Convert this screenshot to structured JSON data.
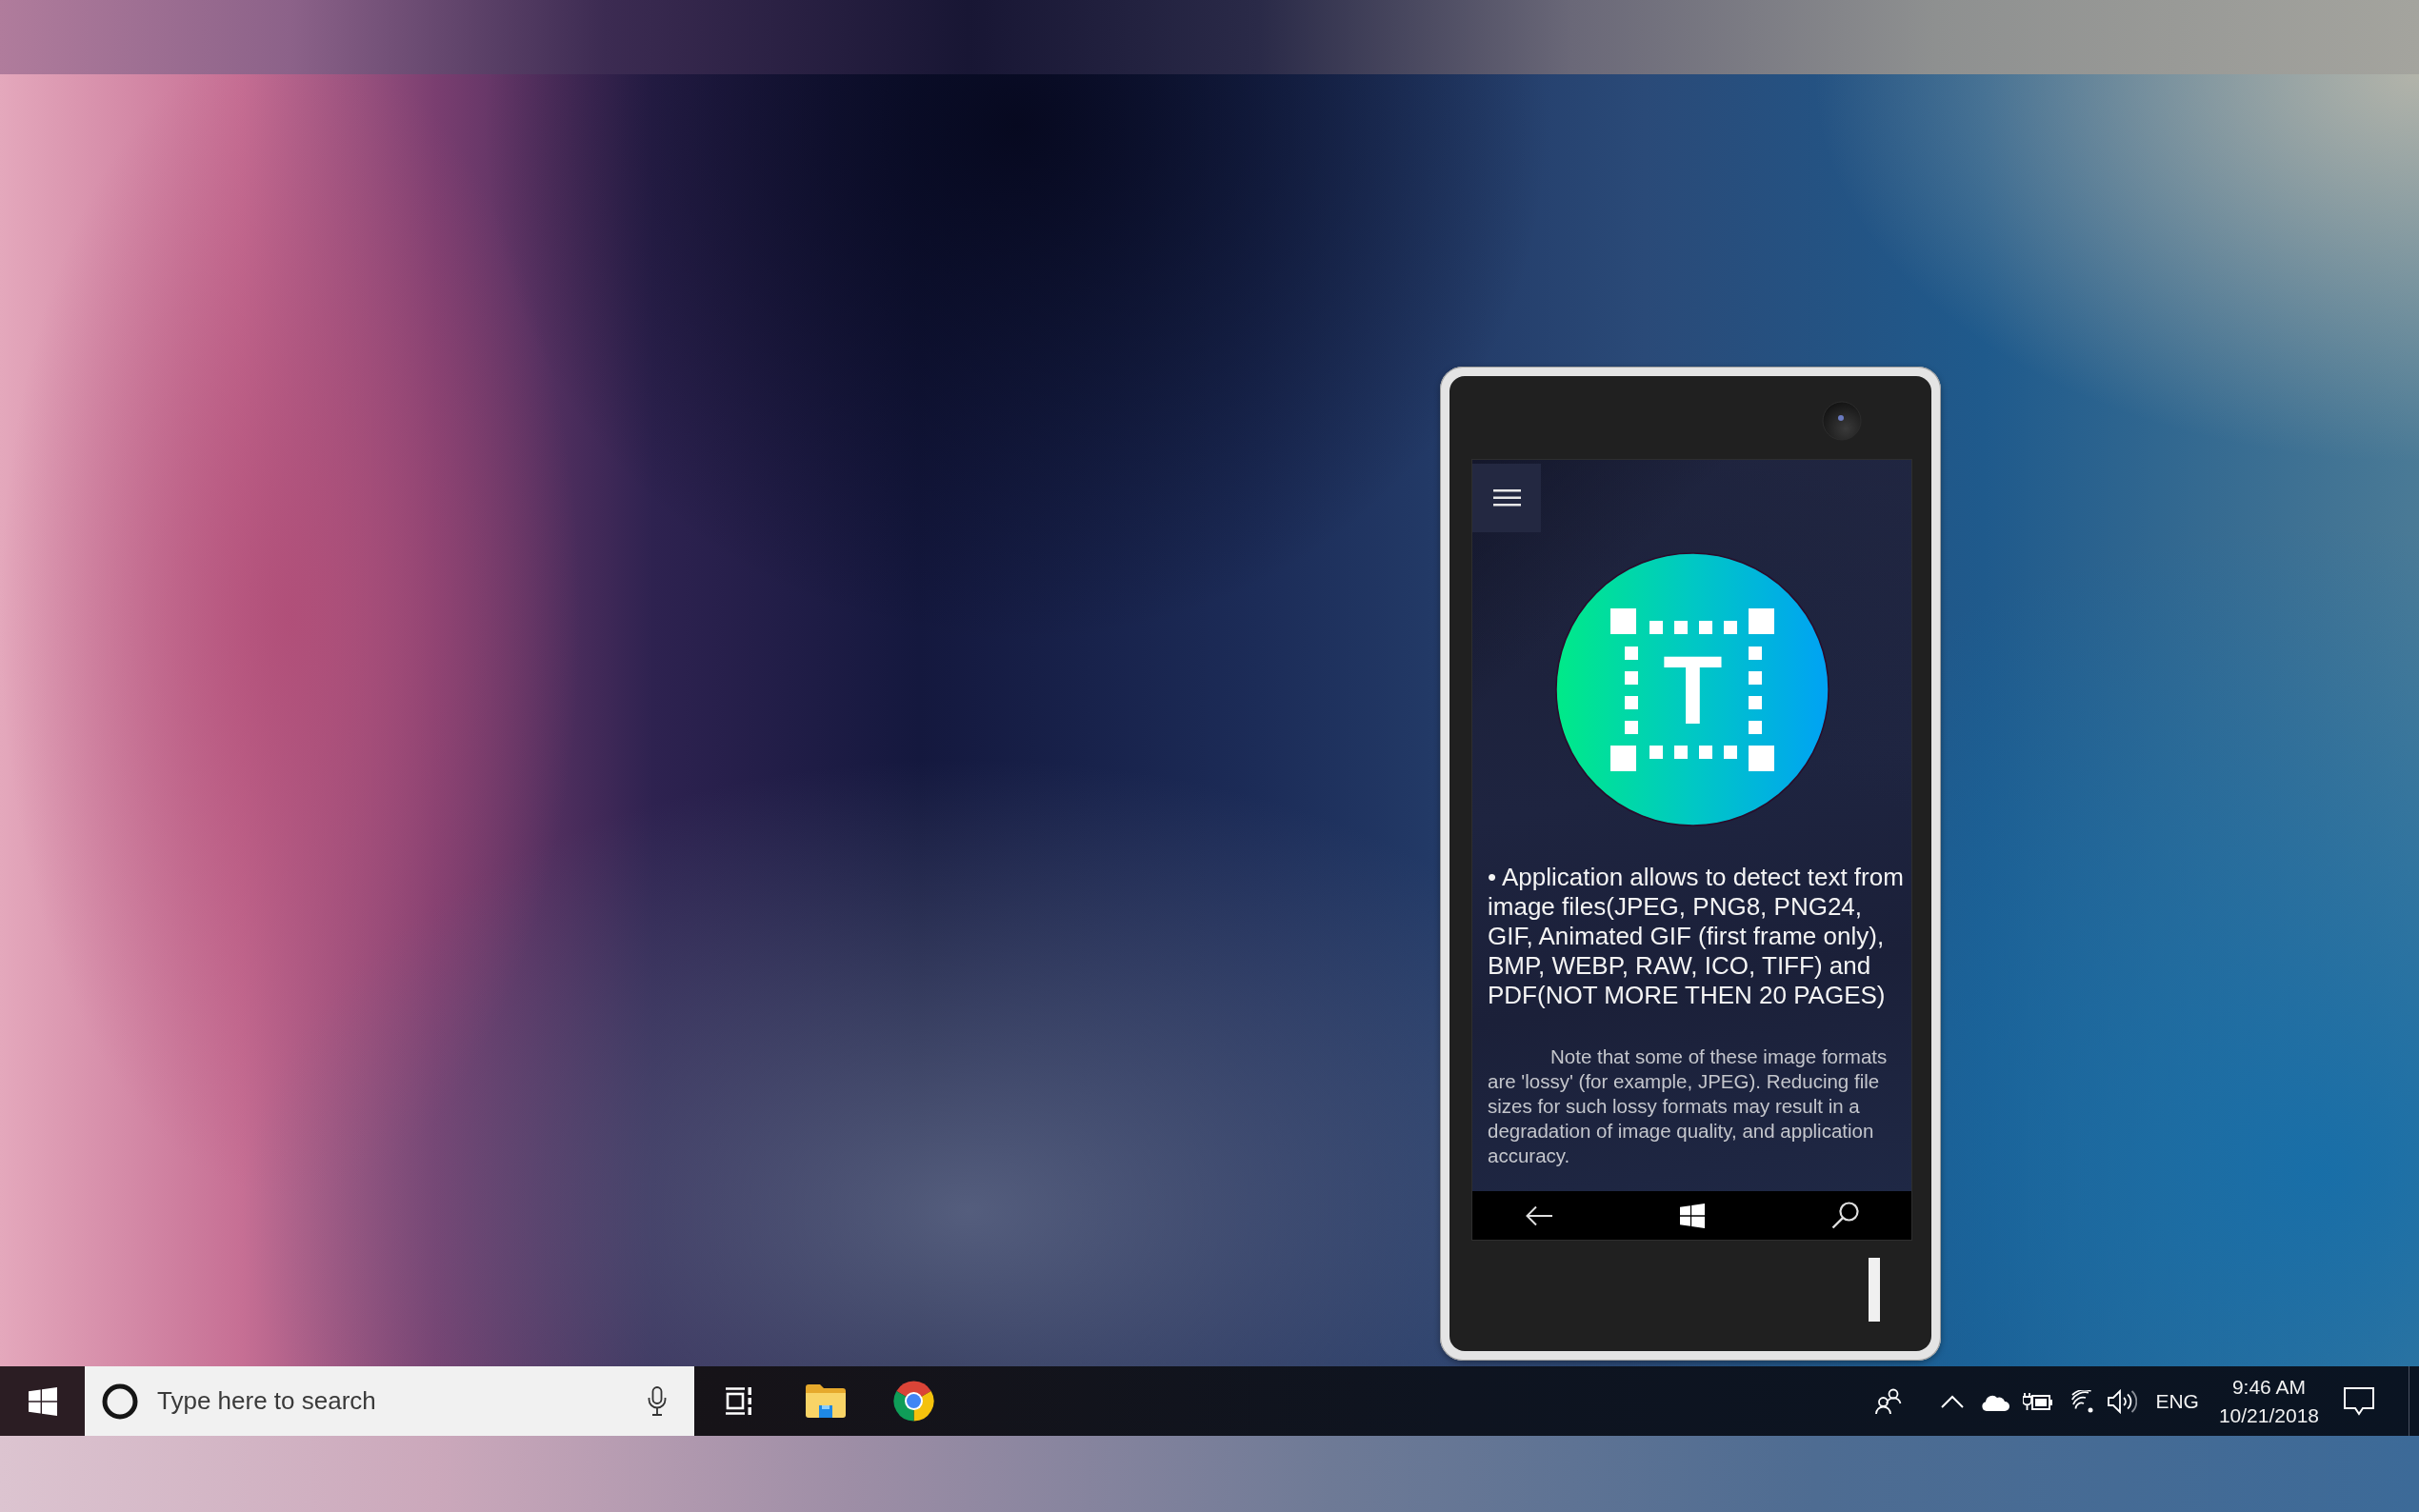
{
  "phone": {
    "app_logo": {
      "letter": "T"
    },
    "description": "• Application allows to detect text from image files(JPEG, PNG8, PNG24, GIF, Animated GIF (first frame only), BMP, WEBP, RAW, ICO, TIFF) and PDF(NOT MORE THEN 20 PAGES)",
    "note": "Note that some of these image formats are 'lossy' (for example, JPEG). Reducing file sizes for such lossy formats may result in a degradation of image quality, and application accuracy."
  },
  "taskbar": {
    "search": {
      "placeholder": "Type here to search"
    },
    "tray": {
      "language": "ENG",
      "time": "9:46 AM",
      "date": "10/21/2018"
    }
  }
}
